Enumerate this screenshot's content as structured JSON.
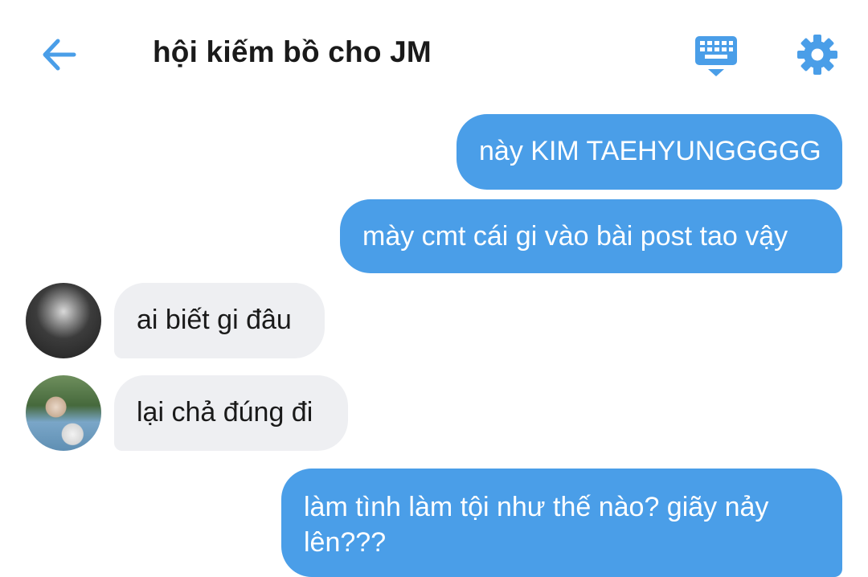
{
  "header": {
    "title": "hội kiếm bồ cho JM",
    "back_icon": "arrow-left-icon",
    "keyboard_icon": "keyboard-icon",
    "settings_icon": "gear-icon"
  },
  "colors": {
    "accent": "#4a9ee8",
    "incoming_bubble": "#eeeff2",
    "title_text": "#1a1a1a"
  },
  "messages": [
    {
      "direction": "outgoing",
      "text": "này KIM TAEHYUNGGGGG"
    },
    {
      "direction": "outgoing",
      "text": "mày cmt cái gi vào bài post tao vậy"
    },
    {
      "direction": "incoming",
      "avatar": "avatar-1",
      "text": "ai biết gi đâu"
    },
    {
      "direction": "incoming",
      "avatar": "avatar-2",
      "text": "lại chả đúng đi"
    },
    {
      "direction": "outgoing",
      "text_line1": "làm tình làm tội như thế nào? giãy nảy",
      "text_line2": "lên???"
    }
  ]
}
